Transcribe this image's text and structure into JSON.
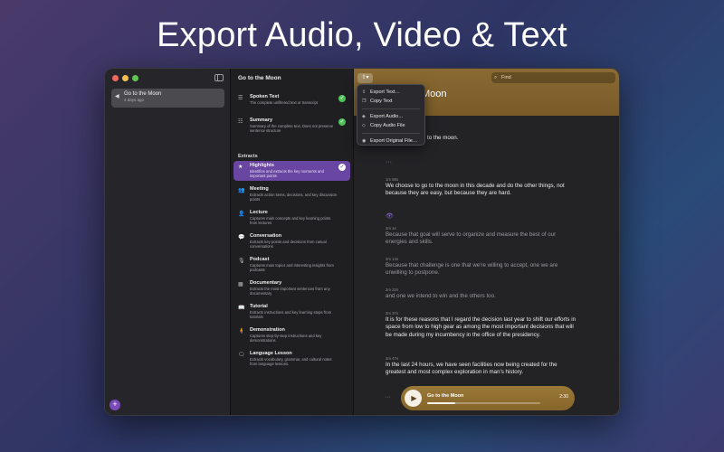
{
  "headline": "Export Audio, Video & Text",
  "sidebar": {
    "documents": [
      {
        "title": "Go to the Moon",
        "subtitle": "4 days ago"
      }
    ],
    "add_label": "+"
  },
  "extracts_panel": {
    "title": "Go to the Moon",
    "base_items": [
      {
        "name": "Spoken Text",
        "desc": "The complete unfiltered text or transcript",
        "checked": true
      },
      {
        "name": "Summary",
        "desc": "Summary of the complete text. Does not preserve sentence structure",
        "checked": true
      }
    ],
    "section_label": "Extracts",
    "items": [
      {
        "name": "Highlights",
        "desc": "Identifies and extracts the key moments and important points",
        "selected": true,
        "checked": true
      },
      {
        "name": "Meeting",
        "desc": "Extracts action items, decisions, and key discussion points"
      },
      {
        "name": "Lecture",
        "desc": "Captures main concepts and key learning points from lectures"
      },
      {
        "name": "Conversation",
        "desc": "Extracts key points and decisions from casual conversations"
      },
      {
        "name": "Podcast",
        "desc": "Captures main topics and interesting insights from podcasts"
      },
      {
        "name": "Documentary",
        "desc": "Extracts the most important sentences from any documentary"
      },
      {
        "name": "Tutorial",
        "desc": "Extracts instructions and key learning steps from tutorials"
      },
      {
        "name": "Demonstration",
        "desc": "Captures step-by-step instructions and key demonstrations"
      },
      {
        "name": "Language Lesson",
        "desc": "Extracts vocabulary, grammar, and cultural notes from language lessons."
      }
    ]
  },
  "toolbar": {
    "share_label": "⇪▾",
    "find_placeholder": "Find",
    "heading_visible": "Moon"
  },
  "export_menu": {
    "group1": [
      "Export Text…",
      "Copy Text"
    ],
    "group2": [
      "Export Audio…",
      "Copy Audio File"
    ],
    "group3": [
      "Export Original File…"
    ]
  },
  "transcript": {
    "first_line": "to the moon.",
    "blocks": [
      {
        "ts": "1m 58s",
        "text": "We choose to go to the moon in this decade and do the other things, not because they are easy, but because they are hard.",
        "dim": false
      },
      {
        "ts": "2m 1s",
        "text": "Because that goal will serve to organize and measure the best of our energies and skills.",
        "dim": true
      },
      {
        "ts": "2m 14s",
        "text": "Because that challenge is one that we're willing to accept, one we are unwilling to postpone.",
        "dim": true
      },
      {
        "ts": "2m 22s",
        "text": "and one we intend to win and the others too.",
        "dim": true
      },
      {
        "ts": "2m 37s",
        "text": "It is for these reasons that I regard the decision last year to shift our efforts in space from low to high gear as among the most important decisions that will be made during my incumbency in the office of the presidency.",
        "dim": false
      },
      {
        "ts": "2m 47s",
        "text": "In the last 24 hours, we have seen facilities now being created for the greatest and most complex exploration in man's history.",
        "dim": false
      }
    ]
  },
  "player": {
    "title": "Go to the Moon",
    "time": "2:30",
    "progress": 0.25
  },
  "colors": {
    "accent_purple": "#6a46a3",
    "header_gold": "#8a6a32",
    "check_green": "#4fc35a"
  }
}
